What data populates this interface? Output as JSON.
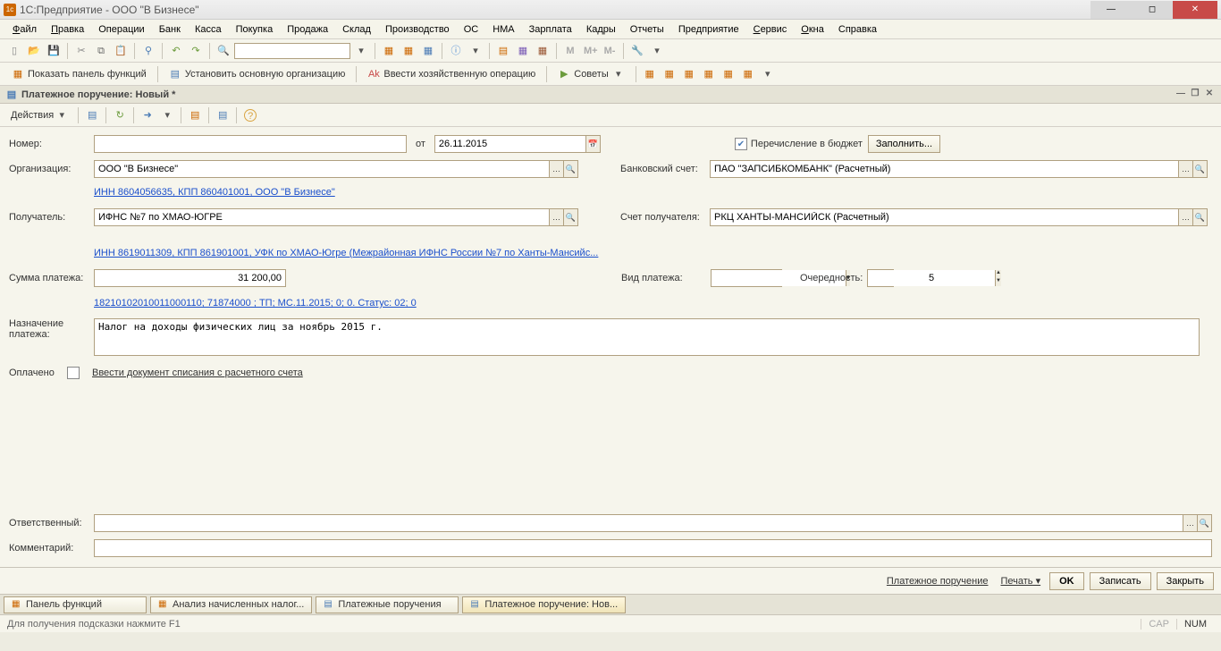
{
  "title": "1С:Предприятие - ООО \"В Бизнесе\"",
  "menu": [
    "Файл",
    "Правка",
    "Операции",
    "Банк",
    "Касса",
    "Покупка",
    "Продажа",
    "Склад",
    "Производство",
    "ОС",
    "НМА",
    "Зарплата",
    "Кадры",
    "Отчеты",
    "Предприятие",
    "Сервис",
    "Окна",
    "Справка"
  ],
  "toolbar2": {
    "show_panel": "Показать панель функций",
    "set_org": "Установить основную организацию",
    "enter_op": "Ввести хозяйственную операцию",
    "advice": "Советы"
  },
  "doc_title": "Платежное поручение: Новый *",
  "doc_toolbar": {
    "actions": "Действия"
  },
  "labels": {
    "number": "Номер:",
    "ot": "от",
    "org": "Организация:",
    "recipient": "Получатель:",
    "sum": "Сумма платежа:",
    "purpose": "Назначение платежа:",
    "paid": "Оплачено",
    "budget": "Перечисление в бюджет",
    "fill": "Заполнить...",
    "bank_acc": "Банковский счет:",
    "rec_acc": "Счет получателя:",
    "pay_kind": "Вид платежа:",
    "priority": "Очередность:",
    "responsible": "Ответственный:",
    "comment": "Комментарий:"
  },
  "values": {
    "number": "",
    "date": "26.11.2015",
    "org": "ООО \"В Бизнесе\"",
    "org_link": "ИНН 8604056635, КПП 860401001, ООО \"В Бизнесе\"",
    "recipient": "ИФНС №7 по ХМАО-ЮГРЕ",
    "recipient_link": "ИНН 8619011309, КПП 861901001, УФК по ХМАО-Югре (Межрайонная ИФНС России №7 по Ханты-Мансийс...",
    "sum": "31 200,00",
    "kbk_link": "18210102010011000110; 71874000   ; ТП; МС.11.2015; 0; 0. Статус: 02; 0",
    "purpose": "Налог на доходы физических лиц за ноябрь 2015 г.",
    "paid_link": "Ввести документ списания с расчетного счета",
    "bank_acc": "ПАО \"ЗАПСИБКОМБАНК\" (Расчетный)",
    "rec_acc": "РКЦ ХАНТЫ-МАНСИЙСК (Расчетный)",
    "pay_kind": "",
    "priority": "5",
    "responsible": "",
    "comment": ""
  },
  "footer": {
    "doc_name": "Платежное поручение",
    "print": "Печать",
    "ok": "OK",
    "save": "Записать",
    "close": "Закрыть"
  },
  "tabs": [
    "Панель функций",
    "Анализ начисленных налог...",
    "Платежные поручения",
    "Платежное поручение: Нов..."
  ],
  "status": {
    "hint": "Для получения подсказки нажмите F1",
    "cap": "CAP",
    "num": "NUM"
  }
}
